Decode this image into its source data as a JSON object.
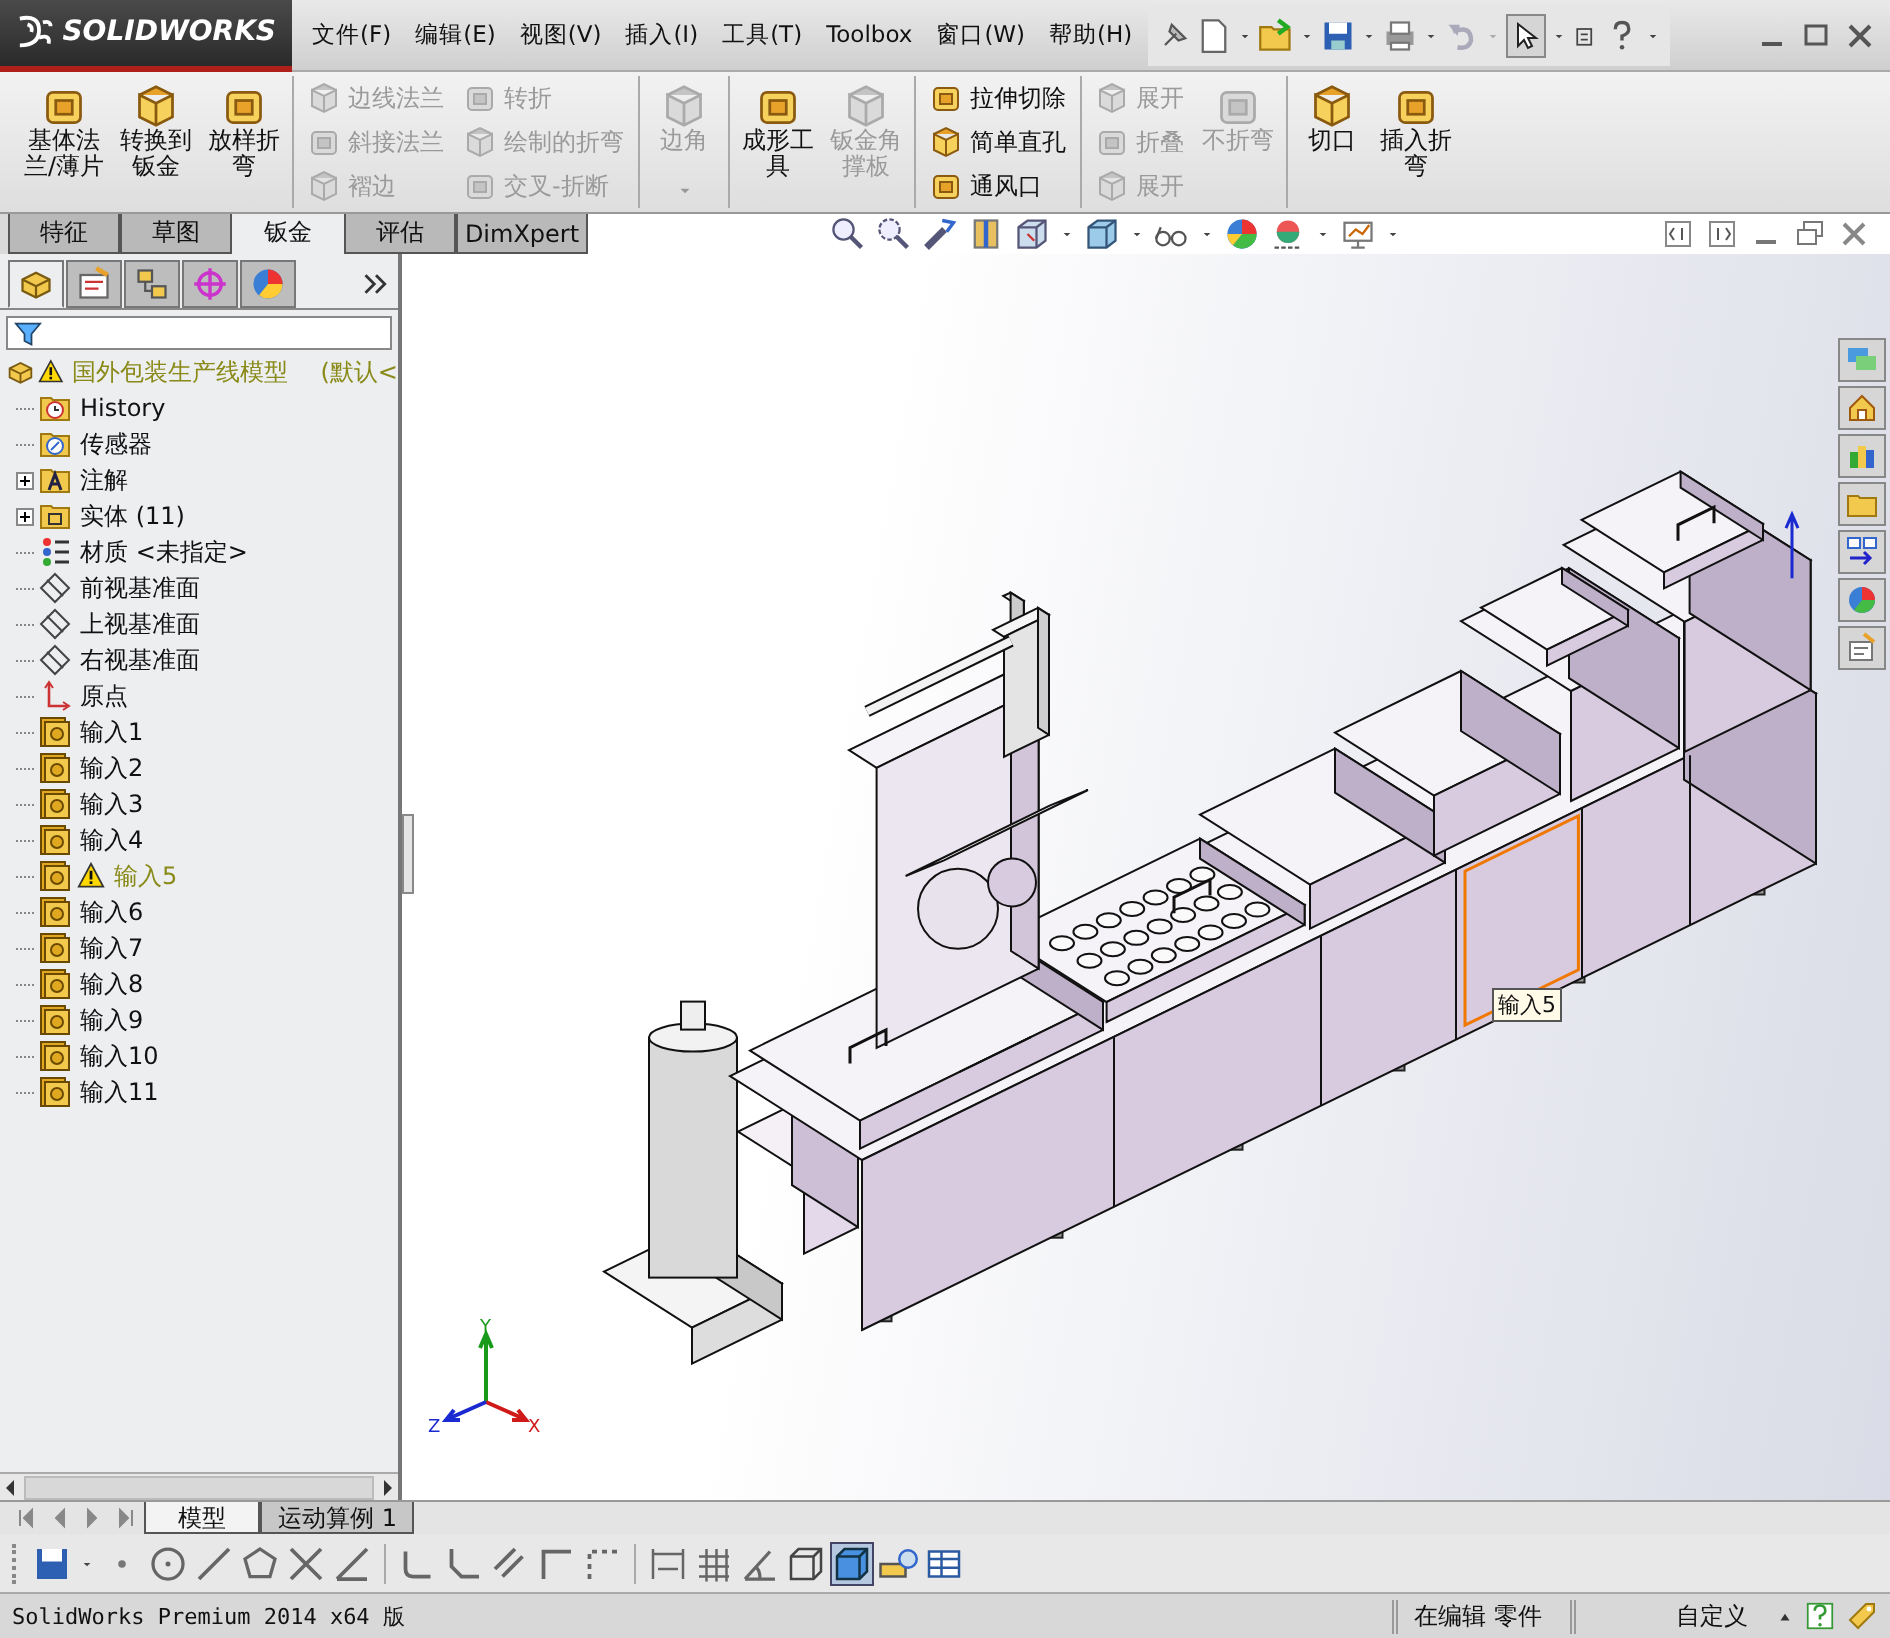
{
  "logo": {
    "text": "SOLIDWORKS"
  },
  "menu": [
    {
      "label": "文件(F)"
    },
    {
      "label": "编辑(E)"
    },
    {
      "label": "视图(V)"
    },
    {
      "label": "插入(I)"
    },
    {
      "label": "工具(T)"
    },
    {
      "label": "Toolbox"
    },
    {
      "label": "窗口(W)"
    },
    {
      "label": "帮助(H)"
    }
  ],
  "ribbon": {
    "groups": [
      {
        "items": [
          {
            "kind": "large",
            "lines": [
              "基体法",
              "兰/薄片"
            ],
            "disabled": false
          },
          {
            "kind": "large",
            "lines": [
              "转换到",
              "钣金"
            ],
            "disabled": false
          },
          {
            "kind": "large",
            "lines": [
              "放样折",
              "弯"
            ],
            "disabled": false
          }
        ]
      },
      {
        "items": [
          {
            "kind": "small",
            "label": "边线法兰",
            "disabled": true
          },
          {
            "kind": "small",
            "label": "斜接法兰",
            "disabled": true
          },
          {
            "kind": "small",
            "label": "褶边",
            "disabled": true
          },
          {
            "kind": "small",
            "label": "转折",
            "disabled": true
          },
          {
            "kind": "small",
            "label": "绘制的折弯",
            "disabled": true
          },
          {
            "kind": "small",
            "label": "交叉-折断",
            "disabled": true
          }
        ]
      },
      {
        "items": [
          {
            "kind": "dropdown",
            "lines": [
              "边角"
            ],
            "disabled": true
          }
        ]
      },
      {
        "items": [
          {
            "kind": "large",
            "lines": [
              "成形工",
              "具"
            ],
            "disabled": false
          },
          {
            "kind": "large",
            "lines": [
              "钣金角",
              "撑板"
            ],
            "disabled": true
          }
        ]
      },
      {
        "items": [
          {
            "kind": "small",
            "label": "拉伸切除",
            "disabled": false
          },
          {
            "kind": "small",
            "label": "简单直孔",
            "disabled": false
          },
          {
            "kind": "small",
            "label": "通风口",
            "disabled": false
          }
        ]
      },
      {
        "items": [
          {
            "kind": "small",
            "label": "展开",
            "disabled": true
          },
          {
            "kind": "small",
            "label": "折叠",
            "disabled": true
          },
          {
            "kind": "small",
            "label": "展开",
            "disabled": true
          },
          {
            "kind": "large",
            "lines": [
              "不折弯"
            ],
            "disabled": true
          }
        ]
      },
      {
        "items": [
          {
            "kind": "large",
            "lines": [
              "切口"
            ],
            "disabled": false
          },
          {
            "kind": "large",
            "lines": [
              "插入折",
              "弯"
            ],
            "disabled": false
          }
        ]
      }
    ]
  },
  "panel_tabs": [
    {
      "selected": true
    },
    {
      "selected": false
    },
    {
      "selected": false
    },
    {
      "selected": false
    },
    {
      "selected": false
    }
  ],
  "tabs": [
    {
      "label": "特征",
      "selected": false
    },
    {
      "label": "草图",
      "selected": false
    },
    {
      "label": "钣金",
      "selected": true
    },
    {
      "label": "评估",
      "selected": false
    },
    {
      "label": "DimXpert",
      "selected": false
    }
  ],
  "tree": {
    "root": {
      "label": "国外包装生产线模型",
      "configuration": "(默认<",
      "warning": true
    },
    "items": [
      {
        "kind": "history",
        "label": "History",
        "collapsed": false,
        "warning": false
      },
      {
        "kind": "sensor",
        "label": "传感器",
        "collapsed": false,
        "warning": false
      },
      {
        "kind": "annotation",
        "label": "注解",
        "collapsed": true,
        "warning": false
      },
      {
        "kind": "folder",
        "label": "实体 (11)",
        "collapsed": true,
        "warning": false
      },
      {
        "kind": "material",
        "label": "材质 <未指定>",
        "collapsed": false,
        "warning": false
      },
      {
        "kind": "plane",
        "label": "前视基准面",
        "collapsed": false,
        "warning": false
      },
      {
        "kind": "plane",
        "label": "上视基准面",
        "collapsed": false,
        "warning": false
      },
      {
        "kind": "plane",
        "label": "右视基准面",
        "collapsed": false,
        "warning": false
      },
      {
        "kind": "origin",
        "label": "原点",
        "collapsed": false,
        "warning": false
      },
      {
        "kind": "body",
        "label": "输入1",
        "collapsed": false,
        "warning": false
      },
      {
        "kind": "body",
        "label": "输入2",
        "collapsed": false,
        "warning": false
      },
      {
        "kind": "body",
        "label": "输入3",
        "collapsed": false,
        "warning": false
      },
      {
        "kind": "body",
        "label": "输入4",
        "collapsed": false,
        "warning": false
      },
      {
        "kind": "body",
        "label": "输入5",
        "collapsed": false,
        "warning": true
      },
      {
        "kind": "body",
        "label": "输入6",
        "collapsed": false,
        "warning": false
      },
      {
        "kind": "body",
        "label": "输入7",
        "collapsed": false,
        "warning": false
      },
      {
        "kind": "body",
        "label": "输入8",
        "collapsed": false,
        "warning": false
      },
      {
        "kind": "body",
        "label": "输入9",
        "collapsed": false,
        "warning": false
      },
      {
        "kind": "body",
        "label": "输入10",
        "collapsed": false,
        "warning": false
      },
      {
        "kind": "body",
        "label": "输入11",
        "collapsed": false,
        "warning": false
      }
    ]
  },
  "viewport": {
    "tooltip": "输入5",
    "triad": {
      "y": "Y",
      "z": "Z",
      "x": "X"
    }
  },
  "bottom_tabs": [
    {
      "label": "模型",
      "selected": true
    },
    {
      "label": "运动算例 1",
      "selected": false
    }
  ],
  "status_bar": {
    "product": "SolidWorks Premium 2014 x64 版",
    "mode": "在编辑 零件",
    "units": "自定义"
  }
}
